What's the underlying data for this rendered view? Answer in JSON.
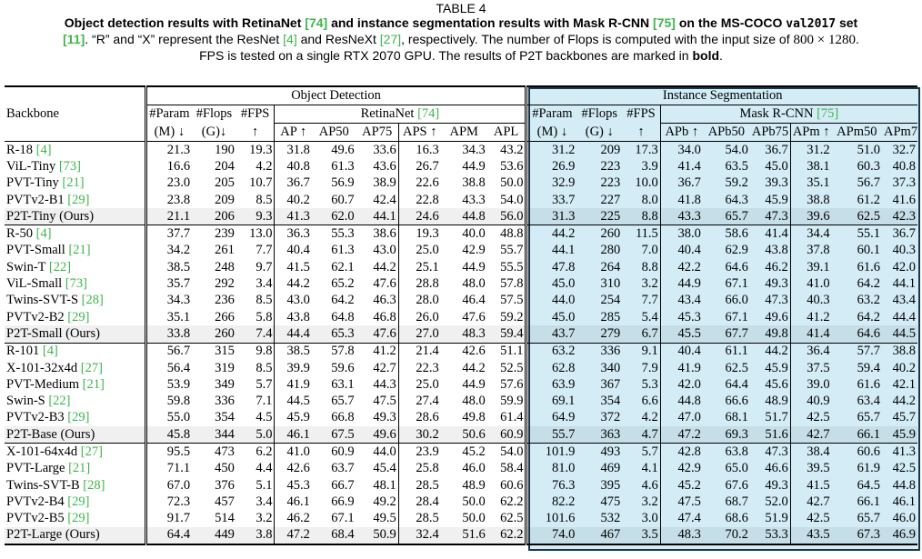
{
  "caption": {
    "label": "TABLE 4",
    "line1_pre": "Object detection results with RetinaNet ",
    "cite_retina": "[74]",
    "line1_mid": " and instance segmentation results with Mask R-CNN ",
    "cite_mask": "[75]",
    "line1_post": " on the MS-COCO ",
    "val_set": "val2017",
    "line1_end": " set",
    "cite_11": "[11]",
    "line2_a": ". “R” and “X” represent the ResNet ",
    "cite_resnet": "[4]",
    "line2_b": " and ResNeXt ",
    "cite_resnext": "[27]",
    "line2_c": ", respectively. The number of Flops is computed with the input size of ",
    "input_size": "800 × 1280",
    "line2_d": ".",
    "line3_a": "FPS is tested on a single RTX 2070 GPU. The results of P2T backbones are marked in ",
    "line3_bold": "bold",
    "line3_end": "."
  },
  "header": {
    "backbone": "Backbone",
    "object_detection": "Object Detection",
    "instance_segmentation": "Instance Segmentation",
    "param": "#Param",
    "flops": "#Flops",
    "fps": "#FPS",
    "param_unit": "(M) ↓",
    "flops_unit": "(G)↓",
    "fps_unit": "↑",
    "retinanet": "RetinaNet ",
    "retinanet_cite": "[74]",
    "maskrcnn": "Mask R-CNN ",
    "maskrcnn_cite": "[75]",
    "seg_param": "#Param",
    "seg_flops": "#Flops",
    "seg_fps": "#FPS",
    "seg_param_unit": "(M) ↓",
    "seg_flops_unit": "(G) ↓",
    "seg_fps_unit": "↑",
    "det_cols": [
      "AP ↑",
      "AP50",
      "AP75",
      "APS ↑",
      "APM",
      "APL"
    ],
    "seg_cols": [
      "APb ↑",
      "APb50",
      "APb75",
      "APm ↑",
      "APm50",
      "APm75"
    ]
  },
  "groups": [
    [
      {
        "name": "R-18 ",
        "cite": "[4]",
        "bold": false,
        "v": [
          "21.3",
          "190",
          "19.3",
          "31.8",
          "49.6",
          "33.6",
          "16.3",
          "34.3",
          "43.2",
          "31.2",
          "209",
          "17.3",
          "34.0",
          "54.0",
          "36.7",
          "31.2",
          "51.0",
          "32.7"
        ]
      },
      {
        "name": "ViL-Tiny ",
        "cite": "[73]",
        "bold": false,
        "v": [
          "16.6",
          "204",
          "4.2",
          "40.8",
          "61.3",
          "43.6",
          "26.7",
          "44.9",
          "53.6",
          "26.9",
          "223",
          "3.9",
          "41.4",
          "63.5",
          "45.0",
          "38.1",
          "60.3",
          "40.8"
        ]
      },
      {
        "name": "PVT-Tiny ",
        "cite": "[21]",
        "bold": false,
        "v": [
          "23.0",
          "205",
          "10.7",
          "36.7",
          "56.9",
          "38.9",
          "22.6",
          "38.8",
          "50.0",
          "32.9",
          "223",
          "10.0",
          "36.7",
          "59.2",
          "39.3",
          "35.1",
          "56.7",
          "37.3"
        ]
      },
      {
        "name": "PVTv2-B1 ",
        "cite": "[29]",
        "bold": false,
        "v": [
          "23.8",
          "209",
          "8.5",
          "40.2",
          "60.7",
          "42.4",
          "22.8",
          "43.3",
          "54.0",
          "33.7",
          "227",
          "8.0",
          "41.8",
          "64.3",
          "45.9",
          "38.8",
          "61.2",
          "41.6"
        ]
      },
      {
        "name": "P2T-Tiny (Ours)",
        "cite": "",
        "bold": true,
        "v": [
          "21.1",
          "206",
          "9.3",
          "41.3",
          "62.0",
          "44.1",
          "24.6",
          "44.8",
          "56.0",
          "31.3",
          "225",
          "8.8",
          "43.3",
          "65.7",
          "47.3",
          "39.6",
          "62.5",
          "42.3"
        ]
      }
    ],
    [
      {
        "name": "R-50 ",
        "cite": "[4]",
        "bold": false,
        "v": [
          "37.7",
          "239",
          "13.0",
          "36.3",
          "55.3",
          "38.6",
          "19.3",
          "40.0",
          "48.8",
          "44.2",
          "260",
          "11.5",
          "38.0",
          "58.6",
          "41.4",
          "34.4",
          "55.1",
          "36.7"
        ]
      },
      {
        "name": "PVT-Small ",
        "cite": "[21]",
        "bold": false,
        "v": [
          "34.2",
          "261",
          "7.7",
          "40.4",
          "61.3",
          "43.0",
          "25.0",
          "42.9",
          "55.7",
          "44.1",
          "280",
          "7.0",
          "40.4",
          "62.9",
          "43.8",
          "37.8",
          "60.1",
          "40.3"
        ]
      },
      {
        "name": "Swin-T ",
        "cite": "[22]",
        "bold": false,
        "v": [
          "38.5",
          "248",
          "9.7",
          "41.5",
          "62.1",
          "44.2",
          "25.1",
          "44.9",
          "55.5",
          "47.8",
          "264",
          "8.8",
          "42.2",
          "64.6",
          "46.2",
          "39.1",
          "61.6",
          "42.0"
        ]
      },
      {
        "name": "ViL-Small ",
        "cite": "[73]",
        "bold": false,
        "v": [
          "35.7",
          "292",
          "3.4",
          "44.2",
          "65.2",
          "47.6",
          "28.8",
          "48.0",
          "57.8",
          "45.0",
          "310",
          "3.2",
          "44.9",
          "67.1",
          "49.3",
          "41.0",
          "64.2",
          "44.1"
        ]
      },
      {
        "name": "Twins-SVT-S ",
        "cite": "[28]",
        "bold": false,
        "v": [
          "34.3",
          "236",
          "8.5",
          "43.0",
          "64.2",
          "46.3",
          "28.0",
          "46.4",
          "57.5",
          "44.0",
          "254",
          "7.7",
          "43.4",
          "66.0",
          "47.3",
          "40.3",
          "63.2",
          "43.4"
        ]
      },
      {
        "name": "PVTv2-B2 ",
        "cite": "[29]",
        "bold": false,
        "v": [
          "35.1",
          "266",
          "5.8",
          "43.8",
          "64.8",
          "46.8",
          "26.0",
          "47.6",
          "59.2",
          "45.0",
          "285",
          "5.4",
          "45.3",
          "67.1",
          "49.6",
          "41.2",
          "64.2",
          "44.4"
        ]
      },
      {
        "name": "P2T-Small (Ours)",
        "cite": "",
        "bold": true,
        "v": [
          "33.8",
          "260",
          "7.4",
          "44.4",
          "65.3",
          "47.6",
          "27.0",
          "48.3",
          "59.4",
          "43.7",
          "279",
          "6.7",
          "45.5",
          "67.7",
          "49.8",
          "41.4",
          "64.6",
          "44.5"
        ]
      }
    ],
    [
      {
        "name": "R-101 ",
        "cite": "[4]",
        "bold": false,
        "v": [
          "56.7",
          "315",
          "9.8",
          "38.5",
          "57.8",
          "41.2",
          "21.4",
          "42.6",
          "51.1",
          "63.2",
          "336",
          "9.1",
          "40.4",
          "61.1",
          "44.2",
          "36.4",
          "57.7",
          "38.8"
        ]
      },
      {
        "name": "X-101-32x4d ",
        "cite": "[27]",
        "bold": false,
        "v": [
          "56.4",
          "319",
          "8.5",
          "39.9",
          "59.6",
          "42.7",
          "22.3",
          "44.2",
          "52.5",
          "62.8",
          "340",
          "7.9",
          "41.9",
          "62.5",
          "45.9",
          "37.5",
          "59.4",
          "40.2"
        ]
      },
      {
        "name": "PVT-Medium ",
        "cite": "[21]",
        "bold": false,
        "v": [
          "53.9",
          "349",
          "5.7",
          "41.9",
          "63.1",
          "44.3",
          "25.0",
          "44.9",
          "57.6",
          "63.9",
          "367",
          "5.3",
          "42.0",
          "64.4",
          "45.6",
          "39.0",
          "61.6",
          "42.1"
        ]
      },
      {
        "name": "Swin-S ",
        "cite": "[22]",
        "bold": false,
        "v": [
          "59.8",
          "336",
          "7.1",
          "44.5",
          "65.7",
          "47.5",
          "27.4",
          "48.0",
          "59.9",
          "69.1",
          "354",
          "6.6",
          "44.8",
          "66.6",
          "48.9",
          "40.9",
          "63.4",
          "44.2"
        ]
      },
      {
        "name": "PVTv2-B3 ",
        "cite": "[29]",
        "bold": false,
        "v": [
          "55.0",
          "354",
          "4.5",
          "45.9",
          "66.8",
          "49.3",
          "28.6",
          "49.8",
          "61.4",
          "64.9",
          "372",
          "4.2",
          "47.0",
          "68.1",
          "51.7",
          "42.5",
          "65.7",
          "45.7"
        ]
      },
      {
        "name": "P2T-Base (Ours)",
        "cite": "",
        "bold": true,
        "v": [
          "45.8",
          "344",
          "5.0",
          "46.1",
          "67.5",
          "49.6",
          "30.2",
          "50.6",
          "60.9",
          "55.7",
          "363",
          "4.7",
          "47.2",
          "69.3",
          "51.6",
          "42.7",
          "66.1",
          "45.9"
        ]
      }
    ],
    [
      {
        "name": "X-101-64x4d ",
        "cite": "[27]",
        "bold": false,
        "v": [
          "95.5",
          "473",
          "6.2",
          "41.0",
          "60.9",
          "44.0",
          "23.9",
          "45.2",
          "54.0",
          "101.9",
          "493",
          "5.7",
          "42.8",
          "63.8",
          "47.3",
          "38.4",
          "60.6",
          "41.3"
        ]
      },
      {
        "name": "PVT-Large ",
        "cite": "[21]",
        "bold": false,
        "v": [
          "71.1",
          "450",
          "4.4",
          "42.6",
          "63.7",
          "45.4",
          "25.8",
          "46.0",
          "58.4",
          "81.0",
          "469",
          "4.1",
          "42.9",
          "65.0",
          "46.6",
          "39.5",
          "61.9",
          "42.5"
        ]
      },
      {
        "name": "Twins-SVT-B ",
        "cite": "[28]",
        "bold": false,
        "v": [
          "67.0",
          "376",
          "5.1",
          "45.3",
          "66.7",
          "48.1",
          "28.5",
          "48.9",
          "60.6",
          "76.3",
          "395",
          "4.6",
          "45.2",
          "67.6",
          "49.3",
          "41.5",
          "64.5",
          "44.8"
        ]
      },
      {
        "name": "PVTv2-B4 ",
        "cite": "[29]",
        "bold": false,
        "v": [
          "72.3",
          "457",
          "3.4",
          "46.1",
          "66.9",
          "49.2",
          "28.4",
          "50.0",
          "62.2",
          "82.2",
          "475",
          "3.2",
          "47.5",
          "68.7",
          "52.0",
          "42.7",
          "66.1",
          "46.1"
        ]
      },
      {
        "name": "PVTv2-B5 ",
        "cite": "[29]",
        "bold": false,
        "v": [
          "91.7",
          "514",
          "3.2",
          "46.2",
          "67.1",
          "49.5",
          "28.5",
          "50.0",
          "62.5",
          "101.6",
          "532",
          "3.0",
          "47.4",
          "68.6",
          "51.9",
          "42.5",
          "65.7",
          "46.0"
        ]
      },
      {
        "name": "P2T-Large (Ours)",
        "cite": "",
        "bold": true,
        "v": [
          "64.4",
          "449",
          "3.8",
          "47.2",
          "68.4",
          "50.9",
          "32.4",
          "51.6",
          "62.2",
          "74.0",
          "467",
          "3.5",
          "48.3",
          "70.2",
          "53.3",
          "43.5",
          "67.3",
          "46.9"
        ]
      }
    ]
  ]
}
